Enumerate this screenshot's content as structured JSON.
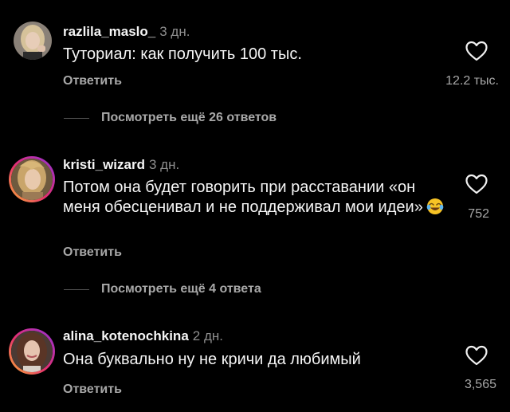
{
  "colors": {
    "background": "#000000",
    "primary_text": "#f5f5f5",
    "secondary_text": "#a8a8a8",
    "timestamp": "#8e8e8e",
    "story_ring": [
      "#f9b233",
      "#e5306e",
      "#b12fb4"
    ]
  },
  "comments": [
    {
      "username": "razlila_maslo_",
      "age": "3 дн.",
      "text": "Туториал: как получить 100 тыс.",
      "reply_label": "Ответить",
      "likes": "12.2 тыс.",
      "avatar_icon": "avatar-woman-blonde",
      "has_story_ring": false
    },
    {
      "username": "kristi_wizard",
      "age": "3 дн.",
      "text": "Потом она будет говорить при расставании «он меня обесценивал и не поддерживал мои идеи»",
      "emoji_icon": "face-with-tears-of-joy-emoji",
      "reply_label": "Ответить",
      "likes": "752",
      "avatar_icon": "avatar-woman-blonde",
      "has_story_ring": true
    },
    {
      "username": "alina_kotenochkina",
      "age": "2 дн.",
      "text": "Она буквально ну не кричи да любимый",
      "reply_label": "Ответить",
      "likes": "3,565",
      "avatar_icon": "avatar-woman-brunette",
      "has_story_ring": true
    }
  ],
  "view_more": [
    {
      "label": "Посмотреть ещё 26 ответов"
    },
    {
      "label": "Посмотреть ещё 4 ответа"
    }
  ],
  "icons": {
    "like": "heart-outline-icon"
  }
}
